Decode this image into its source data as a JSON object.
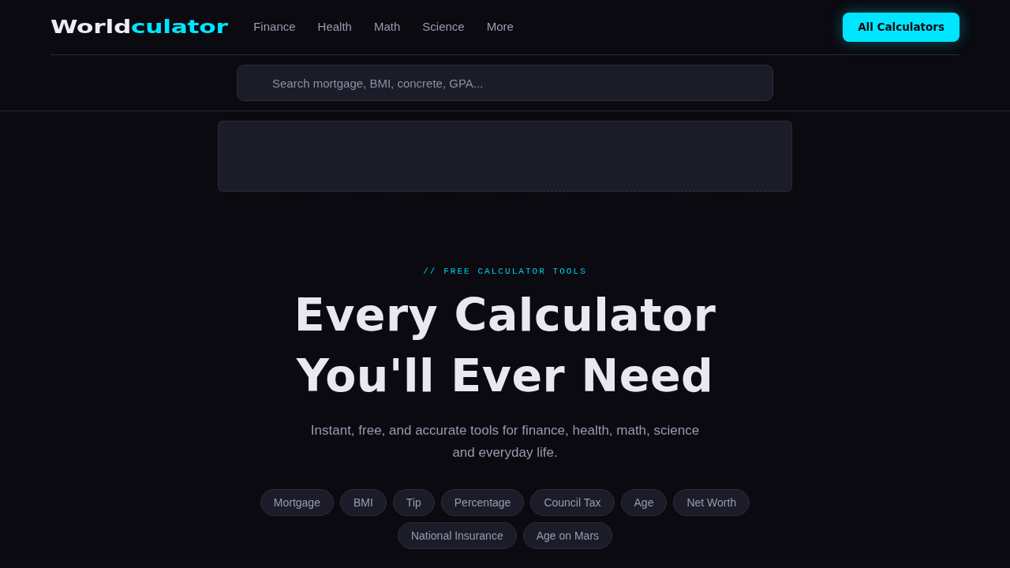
{
  "header": {
    "logo": {
      "primary": "World",
      "accent": "culator"
    },
    "nav": [
      {
        "label": "Finance"
      },
      {
        "label": "Health"
      },
      {
        "label": "Math"
      },
      {
        "label": "Science"
      },
      {
        "label": "More"
      }
    ],
    "cta": "All Calculators"
  },
  "search": {
    "placeholder": "Search mortgage, BMI, concrete, GPA..."
  },
  "hero": {
    "eyebrow": "// FREE CALCULATOR TOOLS",
    "title": "Every Calculator You'll Ever Need",
    "subtitle": "Instant, free, and accurate tools for finance, health, math, science and everyday life.",
    "chips": [
      {
        "label": "Mortgage"
      },
      {
        "label": "BMI"
      },
      {
        "label": "Tip"
      },
      {
        "label": "Percentage"
      },
      {
        "label": "Council Tax"
      },
      {
        "label": "Age"
      },
      {
        "label": "Net Worth"
      },
      {
        "label": "National Insurance"
      },
      {
        "label": "Age on Mars"
      }
    ]
  }
}
